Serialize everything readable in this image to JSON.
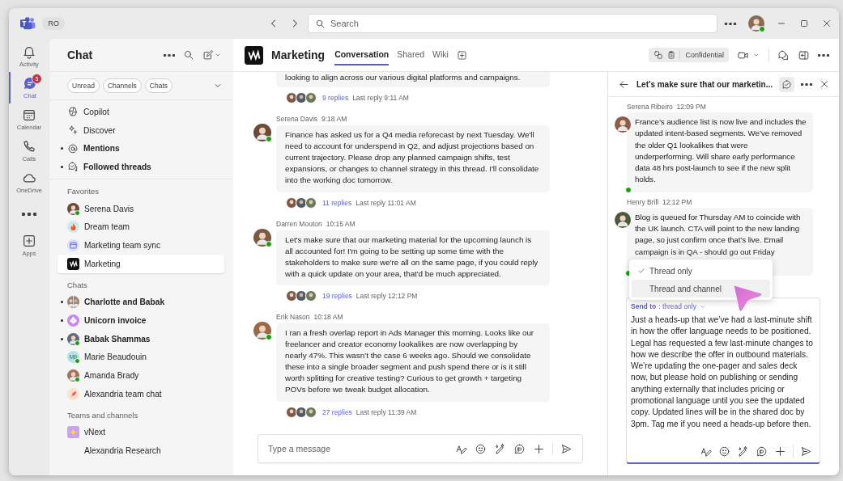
{
  "title_bar": {
    "account": "RO",
    "search_placeholder": "Search"
  },
  "rail": [
    {
      "kind": "bell",
      "label": "Activity",
      "selected": false
    },
    {
      "kind": "chat",
      "label": "Chat",
      "selected": true,
      "badge": "5"
    },
    {
      "kind": "calendar",
      "label": "Calendar",
      "selected": false
    },
    {
      "kind": "phone",
      "label": "Calls",
      "selected": false
    },
    {
      "kind": "cloud",
      "label": "OneDrive",
      "selected": false
    },
    {
      "kind": "more",
      "selected": false
    },
    {
      "kind": "apps",
      "label": "Apps",
      "selected": false
    }
  ],
  "chat_list": {
    "title": "Chat",
    "filters": [
      "Unread",
      "Channels",
      "Chats"
    ],
    "quick": [
      {
        "kind": "copilot",
        "label": "Copilot",
        "unread": false
      },
      {
        "kind": "discover",
        "label": "Discover",
        "unread": false
      },
      {
        "kind": "at",
        "label": "Mentions",
        "unread": true
      },
      {
        "kind": "threads",
        "label": "Followed threads",
        "unread": true
      }
    ],
    "sections": [
      {
        "heading": "Favorites",
        "items": [
          {
            "label": "Serena Davis",
            "kind": "person",
            "color": "#6b4a3a",
            "online": true,
            "unread": false,
            "selected": false
          },
          {
            "label": "Dream team",
            "kind": "flame",
            "color": "#c8ecf2",
            "online": false,
            "unread": false,
            "selected": false
          },
          {
            "label": "Marketing team sync",
            "kind": "calendar",
            "color": "#dcdcfb",
            "online": false,
            "unread": false,
            "selected": false
          },
          {
            "label": "Marketing",
            "kind": "brand",
            "color": "#111111",
            "online": false,
            "unread": false,
            "selected": true
          }
        ]
      },
      {
        "heading": "Chats",
        "items": [
          {
            "label": "Charlotte and Babak",
            "kind": "group",
            "color": "#9c8570",
            "online": false,
            "unread": true,
            "selected": false
          },
          {
            "label": "Unicorn invoice",
            "kind": "flower",
            "color": "#c58af0",
            "online": false,
            "unread": true,
            "selected": false
          },
          {
            "label": "Babak Shammas",
            "kind": "person",
            "color": "#5d6d7e",
            "online": true,
            "unread": true,
            "selected": false
          },
          {
            "label": "Marie Beaudouin",
            "kind": "initials",
            "initials": "MB",
            "color": "#b3e3e3",
            "online": true,
            "unread": false,
            "selected": false
          },
          {
            "label": "Amanda Brady",
            "kind": "person",
            "color": "#a87060",
            "online": true,
            "unread": false,
            "selected": false
          },
          {
            "label": "Alexandria team chat",
            "kind": "rocket",
            "color": "#fde2c8",
            "online": false,
            "unread": false,
            "selected": false
          }
        ]
      },
      {
        "heading": "Teams and channels",
        "items": [
          {
            "label": "vNext",
            "kind": "sparkle",
            "color": "#c9a2f5",
            "online": false,
            "unread": false,
            "selected": false
          },
          {
            "label": "Alexandria Research",
            "kind": "none",
            "online": false,
            "unread": false,
            "selected": false
          }
        ]
      }
    ]
  },
  "channel": {
    "name": "Marketing",
    "tabs": [
      {
        "label": "Conversation",
        "selected": true
      },
      {
        "label": "Shared",
        "selected": false
      },
      {
        "label": "Wiki",
        "selected": false
      }
    ],
    "sensitivity": "Confidential"
  },
  "posts": [
    {
      "text": "looking to align across our various digital platforms and campaigns.",
      "replies": "9 replies",
      "last_reply": "Last reply 9:11 AM"
    },
    {
      "author": "Serena Davis",
      "time": "9:18 AM",
      "color": "#6b4a3a",
      "online": true,
      "text": "Finance has asked us for a Q4 media reforecast by next Tuesday. We'll need to account for underspend in Q2, and adjust projections based on current trajectory. Please drop any planned campaign shifts, test expansions, or changes to channel strategy in this thread. I'll consolidate into the working doc tomorrow.",
      "replies": "11 replies",
      "last_reply": "Last reply 11:01 AM"
    },
    {
      "author": "Darren Mouton",
      "time": "10:15 AM",
      "color": "#7a5a44",
      "online": true,
      "text": "Let's make sure that our marketing material for the upcoming launch is all accounted for! I'm going to be setting up some time with the stakeholders to make sure we're all on the same page, if you could reply with a quick update on your area, that'd be much appreciated.",
      "replies": "19 replies",
      "last_reply": "Last reply 12:12 PM"
    },
    {
      "author": "Erik Nason",
      "time": "10:18 AM",
      "color": "#9a6a48",
      "online": true,
      "text": "I ran a fresh overlap report in Ads Manager this morning. Looks like our freelancer and creator economy lookalikes are now overlapping by nearly 47%. This wasn’t the case 6 weeks ago. Should we consolidate these into a single broader segment and push spend there or is it still worth splitting for creative testing? Curious to get growth + targeting POVs before we tweak budget allocation.",
      "replies": "27 replies",
      "last_reply": "Last reply 11:39 AM"
    }
  ],
  "composer": {
    "placeholder": "Type a message"
  },
  "thread": {
    "title": "Let's make sure that our marketin...",
    "messages": [
      {
        "author": "Serena Ribeiro",
        "time": "12:09 PM",
        "color": "#8a5a4a",
        "online": true,
        "text": "France’s audience list is now live and includes the updated intent-based segments. We’ve removed the older Q1 lookalikes that were underperforming. Will share early performance data 48 hrs post-launch to see if the new split holds."
      },
      {
        "author": "Henry Brill",
        "time": "12:12 PM",
        "color": "#4a5a3a",
        "online": true,
        "text": "Blog is queued for Thursday AM to coincide with the UK launch. CTA will point to the new landing page, so just confirm once that’s live. Email campaign is in QA - should go out Friday"
      }
    ],
    "menu": [
      {
        "label": "Thread only",
        "selected": true,
        "hovered": false
      },
      {
        "label": "Thread and channel",
        "selected": false,
        "hovered": true
      }
    ],
    "send_to": "**Send to**: thread only",
    "draft": "Just a heads-up that we’ve had a last-minute shift in how the offer language needs to be positioned. Legal has requested a few last-minute changes to how we describe the offer in outbound materials. We’re updating the one-pager and sales deck now, but please hold on publishing or sending anything externally that includes pricing or promotional language until you see the updated copy. Updated lines will be in the shared doc by 3pm. Tag me if you need a heads-up before then."
  }
}
